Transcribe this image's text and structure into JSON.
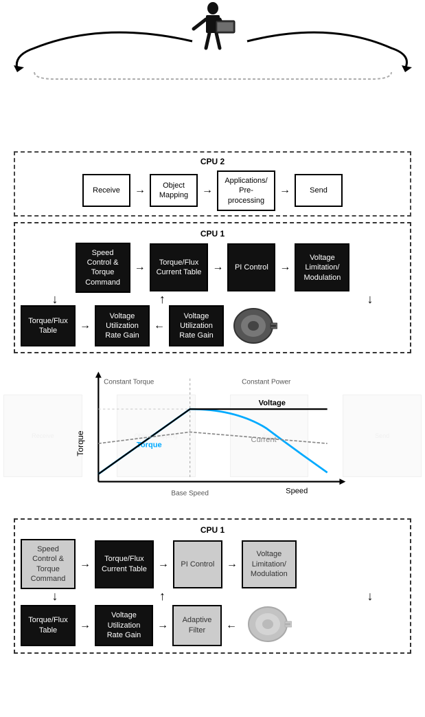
{
  "cpu2": {
    "label": "CPU 2",
    "blocks": [
      "Receive",
      "Object\nMapping",
      "Applications/\nPre-\nprocessing",
      "Send"
    ]
  },
  "cpu1_top": {
    "label": "CPU 1",
    "row1": [
      "Speed\nControl &\nTorque\nCommand",
      "Torque/Flux\nCurrent Table",
      "PI Control",
      "Voltage\nLimitation/\nModulation"
    ],
    "row2": [
      "Torque/Flux\nTable",
      "Voltage\nUtilization\nRate Gain",
      "Voltage\nUtilization\nRate Gain"
    ]
  },
  "chart": {
    "title_left": "Constant Torque",
    "title_right": "Constant Power",
    "y_label": "Torque",
    "x_label": "Speed",
    "base_speed_label": "Base Speed",
    "lines": {
      "torque_label": "Torque",
      "voltage_label": "Voltage",
      "current_label": "Current"
    }
  },
  "cpu1_bottom": {
    "label": "CPU 1",
    "row1": [
      {
        "text": "Speed\nControl &\nTorque\nCommand",
        "style": "gray"
      },
      {
        "text": "Torque/Flux\nCurrent Table",
        "style": "black"
      },
      {
        "text": "PI Control",
        "style": "gray"
      },
      {
        "text": "Voltage\nLimitation/\nModulation",
        "style": "gray"
      }
    ],
    "row2": [
      {
        "text": "Torque/Flux\nTable",
        "style": "black"
      },
      {
        "text": "Voltage\nUtilization\nRate Gain",
        "style": "black"
      },
      {
        "text": "Adaptive\nFilter",
        "style": "gray"
      }
    ]
  }
}
